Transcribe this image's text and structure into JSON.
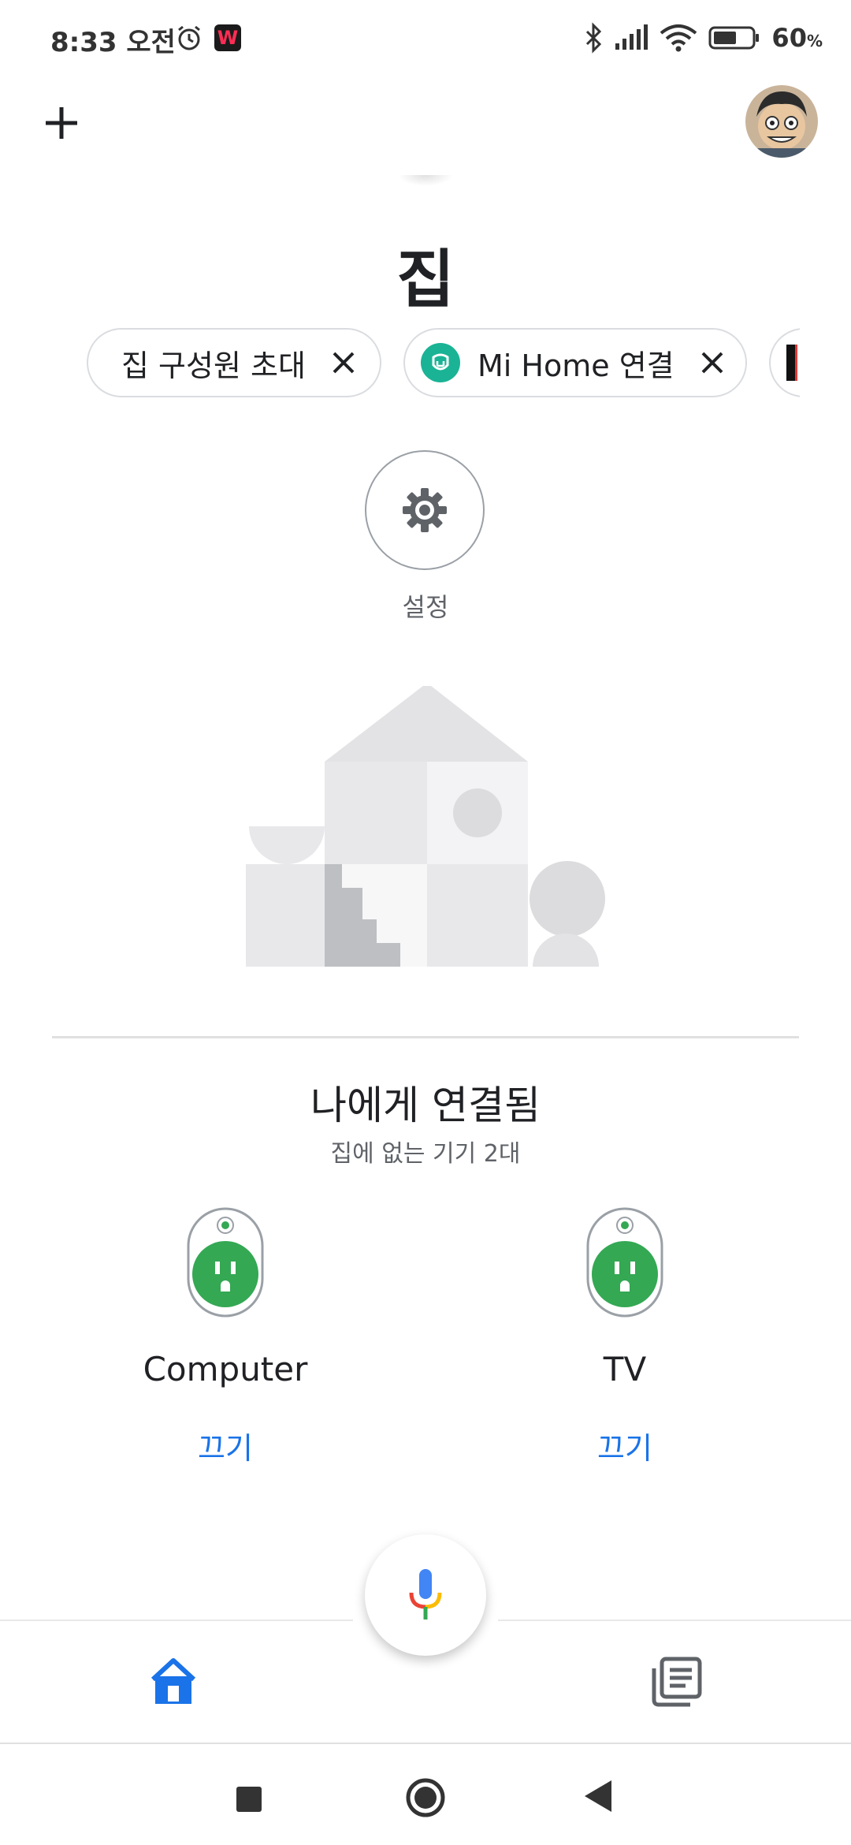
{
  "status_bar": {
    "time": "8:33 오전",
    "app_badge": "W",
    "battery_value": "60",
    "battery_unit": "%"
  },
  "header": {
    "add_icon": "plus-icon",
    "avatar": "profile-avatar"
  },
  "home": {
    "title": "집"
  },
  "chips": [
    {
      "label": "집 구성원 초대"
    },
    {
      "label": "Mi Home 연결"
    }
  ],
  "settings": {
    "label": "설정",
    "icon": "gear-icon"
  },
  "section": {
    "title": "나에게 연결됨",
    "subtitle": "집에 없는 기기 2대"
  },
  "devices": [
    {
      "name": "Computer",
      "action": "끄기",
      "icon": "smart-plug-icon"
    },
    {
      "name": "TV",
      "action": "끄기",
      "icon": "smart-plug-icon"
    }
  ],
  "bottom_nav": {
    "items": [
      {
        "icon": "home-icon",
        "active": true
      },
      {
        "icon": "feed-icon",
        "active": false
      }
    ],
    "mic_icon": "microphone-icon"
  },
  "colors": {
    "accent": "#1a73e8",
    "plug_green": "#34a853",
    "mi_teal": "#1ab395"
  }
}
